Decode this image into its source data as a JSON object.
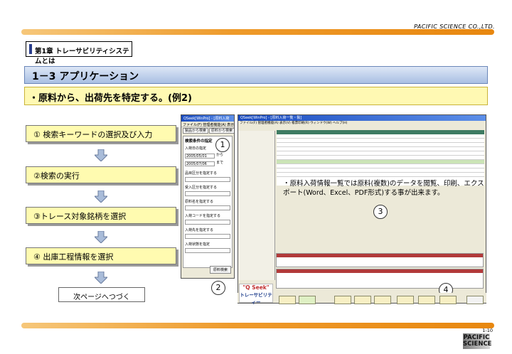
{
  "header": {
    "company": "PACIFIC SCIENCE CO.,LTD."
  },
  "chapter": "第1章 トレーサビリティシステムとは",
  "section_title": "1－3  アプリケーション",
  "subtitle": "・原料から、出荷先を特定する。(例2)",
  "steps": [
    {
      "label": "① 検索キーワードの選択及び入力"
    },
    {
      "label": "②検索の実行"
    },
    {
      "label": "③トレース対象銘柄を選択"
    },
    {
      "label": "④ 出庫工程情報を選択"
    }
  ],
  "next_page": "次ページへつづく",
  "callouts": {
    "c1": "1",
    "c2": "2",
    "c3": "3",
    "c4": "4"
  },
  "panel_search": {
    "title": "QSeek[WinPro] - [原料入荷",
    "menu": "ファイル(F) 管理者機能(A) 表示",
    "tabs": [
      "製品から検索",
      "原料から検索"
    ],
    "heading": "検索条件の指定",
    "date_label": "入荷日の指定",
    "date_from": "2005/05/01",
    "date_from_suffix": "から",
    "date_to": "2005/07/06",
    "date_to_suffix": "まで",
    "filters": [
      "品目区分を指定する",
      "受入区分を指定する",
      "原料名を指定する",
      "入荷コードを指定する",
      "入荷先を指定する",
      "入荷状態を指定"
    ],
    "search_button": "原料検索"
  },
  "panel_main": {
    "title": "QSeek[WinPro] - [原料入荷一覧・製]",
    "menu": "ファイル(F) 管理者機能(A) 表示(V) 帳票印刷(R) ウィンドウ(W) ヘルプ(H)"
  },
  "note": "・原料入荷情報一覧では原料(複数)のデータを閲覧、印刷、エクスポート(Word、Excel、PDF形式)する事が出来ます。",
  "logo": {
    "line1": "\"Q Seek\"",
    "line2": "トレーサビリティー"
  },
  "footer": {
    "page": "1-10",
    "brand_line1": "PACIFIC",
    "brand_line2": "SCIENCE"
  }
}
